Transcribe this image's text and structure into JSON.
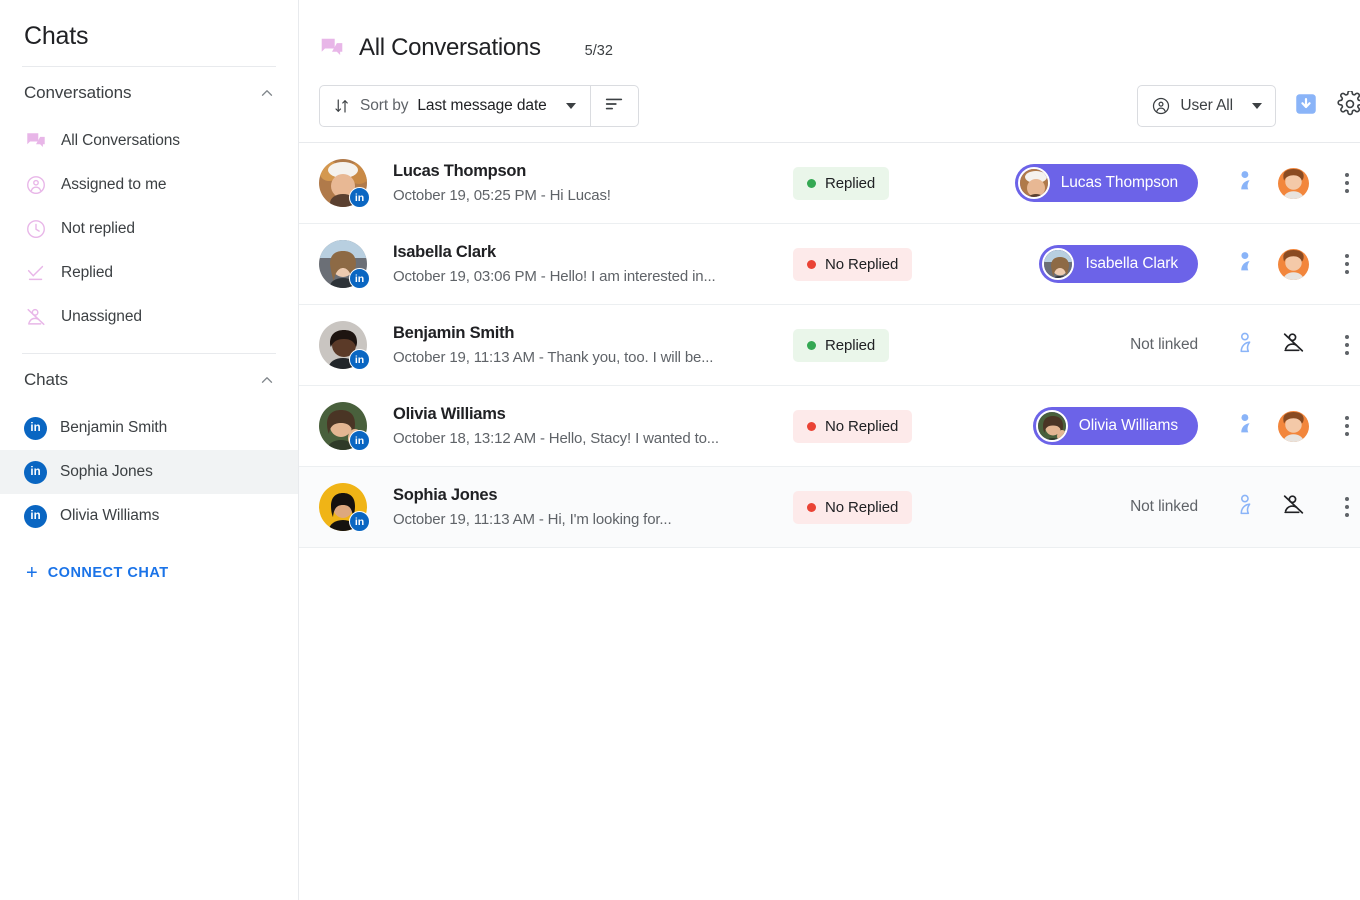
{
  "sidebar": {
    "title": "Chats",
    "conversations_section": {
      "label": "Conversations",
      "collapse_icon": "chevron-up-icon"
    },
    "nav_items": [
      {
        "label": "All Conversations",
        "icon": "chat-bubbles-icon"
      },
      {
        "label": "Assigned to me",
        "icon": "person-circle-icon"
      },
      {
        "label": "Not replied",
        "icon": "clock-icon"
      },
      {
        "label": "Replied",
        "icon": "check-underline-icon"
      },
      {
        "label": "Unassigned",
        "icon": "person-crossed-icon"
      }
    ],
    "chats_section": {
      "label": "Chats",
      "collapse_icon": "chevron-up-icon"
    },
    "chat_items": [
      {
        "label": "Benjamin Smith",
        "icon": "linkedin-icon",
        "active": false
      },
      {
        "label": "Sophia Jones",
        "icon": "linkedin-icon",
        "active": true
      },
      {
        "label": "Olivia Williams",
        "icon": "linkedin-icon",
        "active": false
      }
    ],
    "connect_chat": {
      "label": "CONNECT CHAT",
      "icon": "plus-icon",
      "color": "#1a73e8"
    }
  },
  "header": {
    "icon": "chat-bubbles-icon",
    "title": "All Conversations",
    "counter": "5/32"
  },
  "toolbar": {
    "sort": {
      "icon": "sort-arrows-icon",
      "prefix": "Sort by",
      "value": "Last message date",
      "caret_icon": "chevron-down-icon"
    },
    "sort_direction_icon": "sort-lines-icon",
    "user_filter": {
      "icon": "person-circle-icon",
      "label": "User All",
      "caret_icon": "chevron-down-icon"
    },
    "download_button_icon": "download-box-icon",
    "settings_button_icon": "gear-icon"
  },
  "colors": {
    "accent_purple": "#6c63e8",
    "link_blue": "#1a73e8",
    "linkedin_blue": "#0a66c2",
    "replied_green": "#34a853",
    "no_replied_red": "#ea4335",
    "sidebar_icon_pink": "#e8b6e8",
    "assignee_icon_blue": "#8ab4f8"
  },
  "conversations": [
    {
      "name": "Lucas Thompson",
      "snippet": "October 19, 05:25 PM - Hi Lucas!",
      "status": "Replied",
      "status_type": "replied",
      "linked": true,
      "linked_name": "Lucas Thompson",
      "not_linked_label": "Not linked",
      "assigned": true,
      "source_icon": "linkedin-icon",
      "share_icon": "assign-person-icon",
      "menu_icon": "kebab-menu-icon",
      "tinted": false
    },
    {
      "name": "Isabella Clark",
      "snippet": "October 19, 03:06 PM - Hello! I am interested in...",
      "status": "No Replied",
      "status_type": "noreplied",
      "linked": true,
      "linked_name": "Isabella Clark",
      "not_linked_label": "Not linked",
      "assigned": true,
      "source_icon": "linkedin-icon",
      "share_icon": "assign-person-icon",
      "menu_icon": "kebab-menu-icon",
      "tinted": false
    },
    {
      "name": "Benjamin Smith",
      "snippet": "October 19, 11:13 AM - Thank you, too. I will be...",
      "status": "Replied",
      "status_type": "replied",
      "linked": false,
      "linked_name": "",
      "not_linked_label": "Not linked",
      "assigned": false,
      "source_icon": "linkedin-icon",
      "share_icon": "assign-person-outline-icon",
      "menu_icon": "kebab-menu-icon",
      "tinted": false
    },
    {
      "name": "Olivia Williams",
      "snippet": "October 18, 13:12 AM - Hello, Stacy! I wanted to...",
      "status": "No Replied",
      "status_type": "noreplied",
      "linked": true,
      "linked_name": "Olivia Williams",
      "not_linked_label": "Not linked",
      "assigned": true,
      "source_icon": "linkedin-icon",
      "share_icon": "assign-person-icon",
      "menu_icon": "kebab-menu-icon",
      "tinted": false
    },
    {
      "name": "Sophia Jones",
      "snippet": "October 19, 11:13 AM - Hi, I'm looking for...",
      "status": "No Replied",
      "status_type": "noreplied",
      "linked": false,
      "linked_name": "",
      "not_linked_label": "Not linked",
      "assigned": false,
      "source_icon": "linkedin-icon",
      "share_icon": "assign-person-outline-icon",
      "menu_icon": "kebab-menu-icon",
      "tinted": true
    }
  ]
}
